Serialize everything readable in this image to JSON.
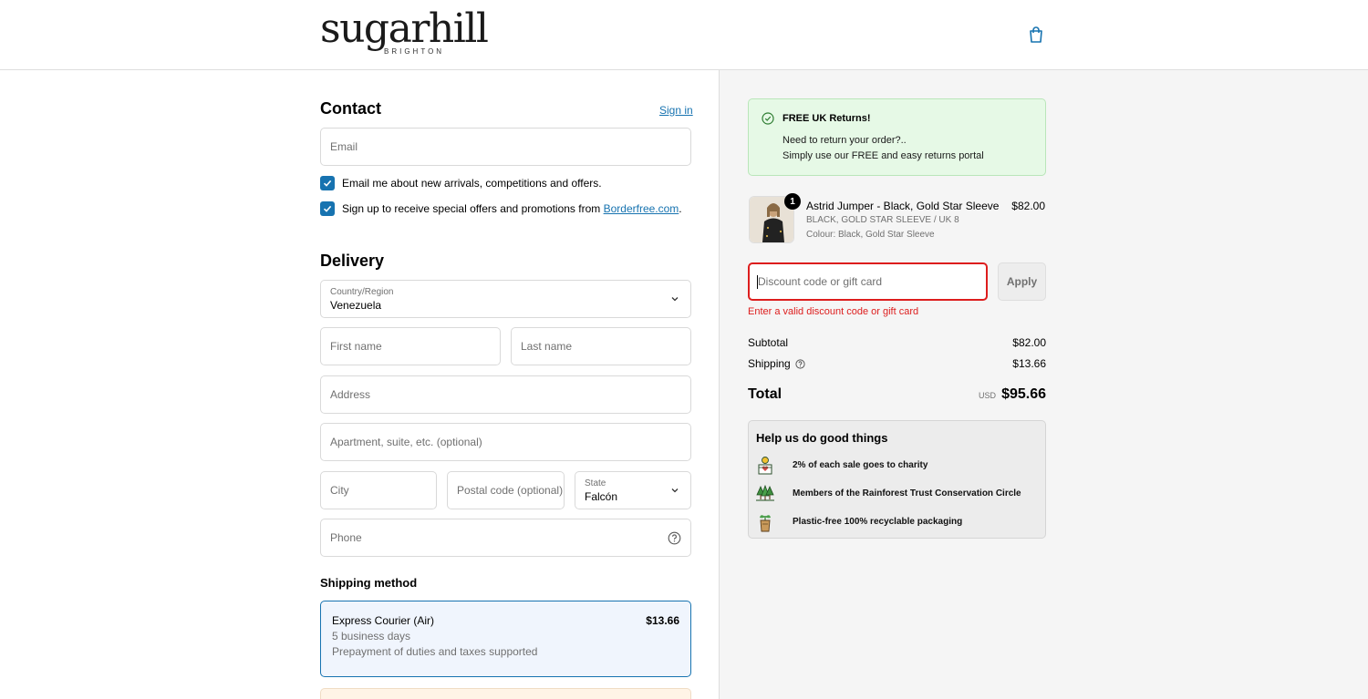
{
  "brand": {
    "name": "sugarhill",
    "sub": "BRIGHTON"
  },
  "colors": {
    "accent": "#1773b0",
    "error": "#dd1d1d",
    "promo_bg": "#e6f9e6"
  },
  "contact": {
    "title": "Contact",
    "sign_in": "Sign in",
    "email_placeholder": "Email",
    "checkbox1": "Email me about new arrivals, competitions and offers.",
    "checkbox2_prefix": "Sign up to receive special offers and promotions from ",
    "checkbox2_link": "Borderfree.com",
    "checkbox2_suffix": "."
  },
  "delivery": {
    "title": "Delivery",
    "country_label": "Country/Region",
    "country_value": "Venezuela",
    "first_name": "First name",
    "last_name": "Last name",
    "address": "Address",
    "apartment": "Apartment, suite, etc. (optional)",
    "city": "City",
    "postal": "Postal code (optional)",
    "state_label": "State",
    "state_value": "Falcón",
    "phone": "Phone"
  },
  "shipping": {
    "title": "Shipping method",
    "option_name": "Express Courier (Air)",
    "option_price": "$13.66",
    "option_days": "5 business days",
    "option_note": "Prepayment of duties and taxes supported"
  },
  "promo": {
    "title": "FREE UK Returns!",
    "line1": "Need to return your order?..",
    "line2": "Simply use our FREE and easy returns portal"
  },
  "item": {
    "qty": "1",
    "name": "Astrid Jumper - Black, Gold Star Sleeve",
    "variant": "BLACK, GOLD STAR SLEEVE / UK 8",
    "colour": "Colour: Black, Gold Star Sleeve",
    "price": "$82.00"
  },
  "discount": {
    "placeholder": "Discount code or gift card",
    "apply": "Apply",
    "error": "Enter a valid discount code or gift card"
  },
  "summary": {
    "subtotal_label": "Subtotal",
    "subtotal": "$82.00",
    "shipping_label": "Shipping",
    "shipping": "$13.66",
    "total_label": "Total",
    "currency": "USD",
    "total": "$95.66"
  },
  "good": {
    "title": "Help us do good things",
    "items": [
      {
        "icon": "charity-icon",
        "text": "2% of each sale goes to charity"
      },
      {
        "icon": "trees-icon",
        "text": "Members of the Rainforest Trust Conservation Circle"
      },
      {
        "icon": "recycle-plant-icon",
        "text": "Plastic-free 100% recyclable packaging"
      }
    ]
  }
}
